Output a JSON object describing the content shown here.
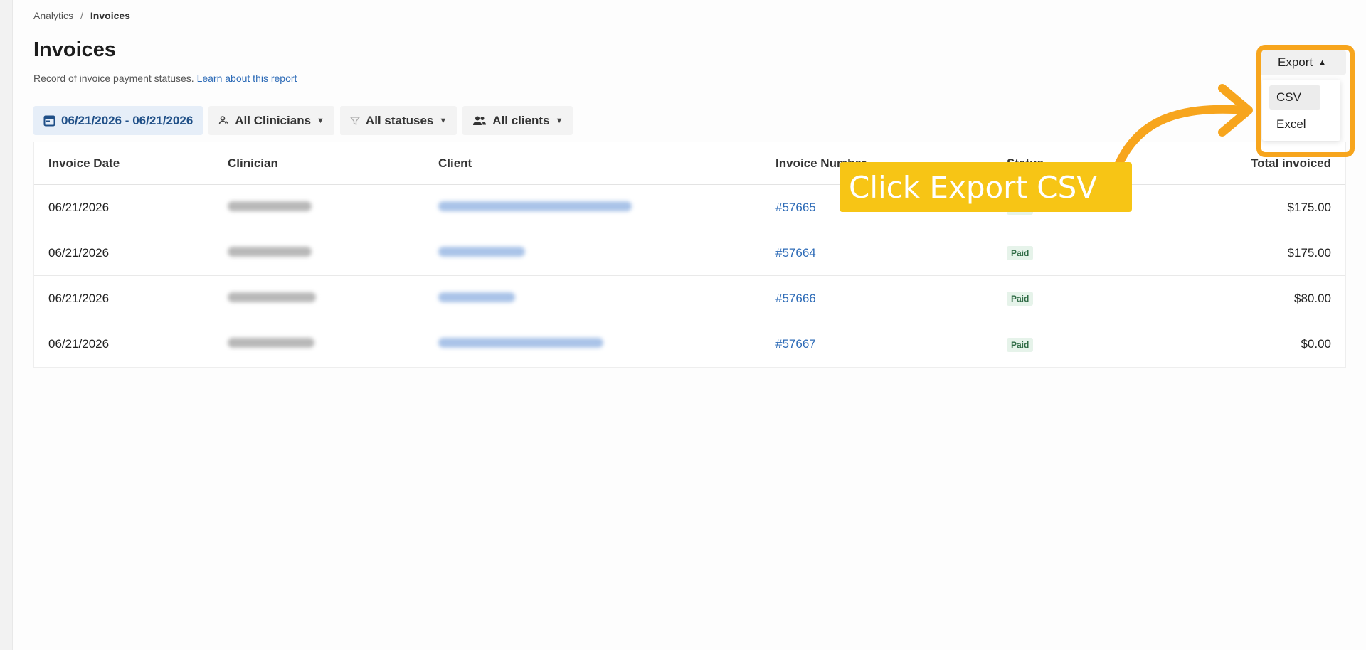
{
  "breadcrumb": {
    "parent": "Analytics",
    "separator": "/",
    "current": "Invoices"
  },
  "page": {
    "title": "Invoices",
    "subtitle": "Record of invoice payment statuses.",
    "learn_link": "Learn about this report"
  },
  "filters": {
    "date_range": "06/21/2026 - 06/21/2026",
    "clinicians": "All Clinicians",
    "statuses": "All statuses",
    "clients": "All clients"
  },
  "export": {
    "label": "Export",
    "options": [
      "CSV",
      "Excel"
    ]
  },
  "table": {
    "columns": [
      "Invoice Date",
      "Clinician",
      "Client",
      "Invoice Number",
      "Status",
      "Total invoiced"
    ],
    "rows": [
      {
        "date": "06/21/2026",
        "invoice_number": "#57665",
        "status": "Paid",
        "total": "$175.00"
      },
      {
        "date": "06/21/2026",
        "invoice_number": "#57664",
        "status": "Paid",
        "total": "$175.00"
      },
      {
        "date": "06/21/2026",
        "invoice_number": "#57666",
        "status": "Paid",
        "total": "$80.00"
      },
      {
        "date": "06/21/2026",
        "invoice_number": "#57667",
        "status": "Paid",
        "total": "$0.00"
      }
    ]
  },
  "annotation": {
    "callout_text": "Click Export CSV",
    "highlight_color": "#f7a51d",
    "callout_color": "#f7c515"
  },
  "icons": {
    "date_filter": "calendar-icon",
    "clinicians_filter": "clinician-icon",
    "statuses_filter": "filter-icon",
    "clients_filter": "people-icon"
  }
}
